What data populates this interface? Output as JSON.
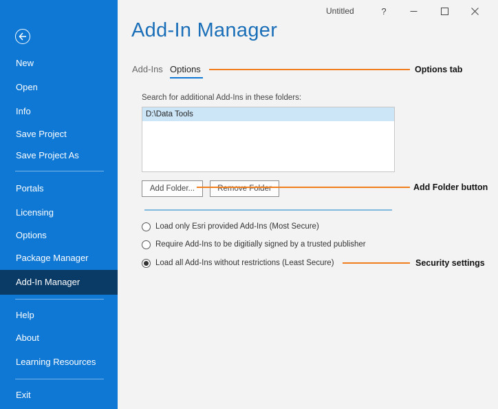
{
  "window": {
    "title": "Untitled",
    "help_glyph": "?",
    "minimize_glyph": "—",
    "maximize_glyph": "☐",
    "close_glyph": "✕"
  },
  "sidebar": {
    "items": [
      {
        "label": "New"
      },
      {
        "label": "Open"
      },
      {
        "label": "Info"
      },
      {
        "label": "Save Project"
      },
      {
        "label": "Save Project As"
      },
      {
        "label": "Portals"
      },
      {
        "label": "Licensing"
      },
      {
        "label": "Options"
      },
      {
        "label": "Package Manager"
      },
      {
        "label": "Add-In Manager",
        "active": true
      },
      {
        "label": "Help"
      },
      {
        "label": "About"
      },
      {
        "label": "Learning Resources"
      },
      {
        "label": "Exit"
      }
    ]
  },
  "main": {
    "title": "Add-In Manager",
    "tabs": [
      {
        "label": "Add-Ins",
        "active": false
      },
      {
        "label": "Options",
        "active": true
      }
    ],
    "search_label": "Search for additional Add-Ins in these folders:",
    "folders": [
      "D:\\Data Tools"
    ],
    "add_folder_label": "Add Folder...",
    "remove_folder_label": "Remove Folder",
    "security_options": [
      {
        "label": "Load only Esri provided Add-Ins (Most Secure)",
        "selected": false
      },
      {
        "label": "Require Add-Ins to be digitially signed by a trusted publisher",
        "selected": false
      },
      {
        "label": "Load all Add-Ins without restrictions (Least Secure)",
        "selected": true
      }
    ]
  },
  "annotations": {
    "options_tab": "Options tab",
    "add_folder_button": "Add Folder button",
    "security_settings": "Security settings"
  },
  "colors": {
    "sidebar_bg": "#0f78d4",
    "sidebar_active": "#0a3a66",
    "title_blue": "#1a6fb8",
    "callout_orange": "#f07c1c"
  }
}
